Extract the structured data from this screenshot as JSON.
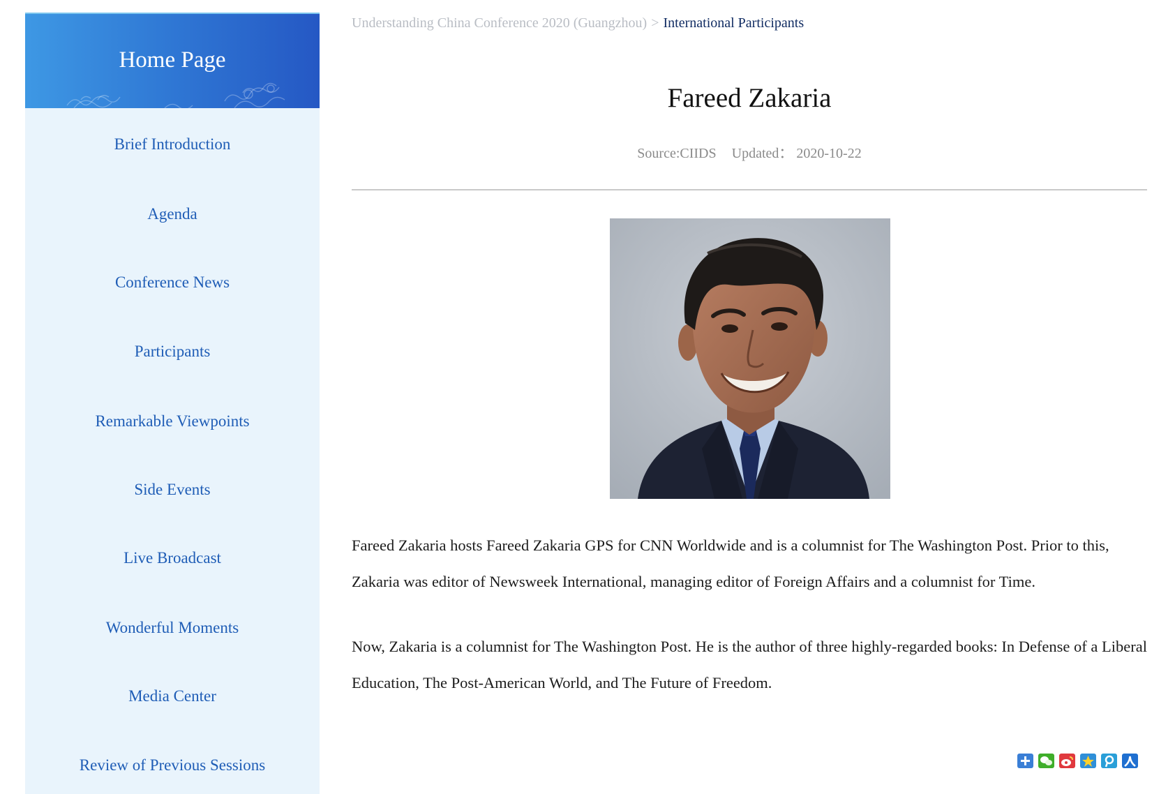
{
  "sidebar": {
    "home_label": "Home Page",
    "items": [
      {
        "label": "Brief Introduction"
      },
      {
        "label": "Agenda"
      },
      {
        "label": "Conference News"
      },
      {
        "label": "Participants"
      },
      {
        "label": "Remarkable Viewpoints"
      },
      {
        "label": "Side Events"
      },
      {
        "label": "Live Broadcast"
      },
      {
        "label": "Wonderful Moments"
      },
      {
        "label": "Media Center"
      },
      {
        "label": "Review of Previous Sessions"
      }
    ]
  },
  "breadcrumb": {
    "parent": "Understanding China Conference 2020 (Guangzhou)",
    "separator": ">",
    "current": "International Participants"
  },
  "article": {
    "title": "Fareed Zakaria",
    "source": "Source:CIIDS",
    "updated": "Updated： 2020-10-22",
    "paragraphs": [
      "Fareed Zakaria hosts Fareed Zakaria GPS for CNN Worldwide and is a columnist for The Washington Post. Prior to this, Zakaria was editor of Newsweek International, managing editor of Foreign Affairs and a columnist for Time.",
      "Now, Zakaria is a columnist for The Washington Post. He is the author of three highly-regarded books: In Defense of a Liberal Education, The Post-American World, and The Future of Freedom."
    ]
  },
  "share_icons": [
    {
      "icon": "plus-icon",
      "color": "#3a7fd6"
    },
    {
      "icon": "wechat-icon",
      "color": "#3fae2a"
    },
    {
      "icon": "weibo-icon",
      "color": "#e0393e"
    },
    {
      "icon": "qzone-icon",
      "color": "#2f8fd8"
    },
    {
      "icon": "tencent-weibo-icon",
      "color": "#2a9fd8"
    },
    {
      "icon": "renren-icon",
      "color": "#1f6fd0"
    }
  ],
  "colors": {
    "sidebar_bg": "#e9f4fc",
    "nav_link": "#1f5db6",
    "header_blue": "#2f77d4"
  }
}
